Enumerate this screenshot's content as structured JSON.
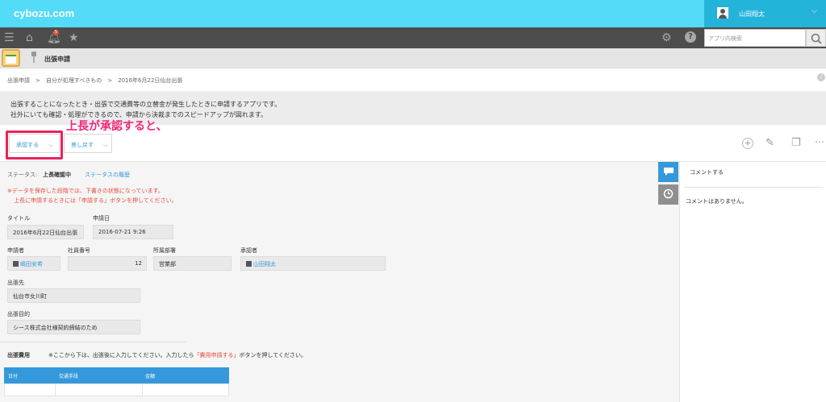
{
  "brand": {
    "logo": "cybozu.com",
    "accent": "#54dbf8",
    "user_bar": "#24b3d9"
  },
  "header": {
    "username": "山田翔太",
    "notification_count": "5",
    "search_placeholder": "アプリ内検索"
  },
  "app": {
    "name": "出張申請"
  },
  "breadcrumb": {
    "text": "出張申請　>　自分が処理すべきもの　>　2016年6月22日仙台出張"
  },
  "description": {
    "line1": "出張することになったとき・出張で交通費等の立替金が発生したときに申請するアプリです。",
    "line2": "社外にいても確認・処理ができるので、申請から決裁までのスピードアップが図れます。"
  },
  "annotation": "上長が承認すると、",
  "actions": {
    "approve": "承認する",
    "send_back": "差し戻す"
  },
  "status": {
    "label": "ステータス:",
    "value": "上長確認中",
    "history_link": "ステータスの履歴"
  },
  "notice": {
    "line1": "※データを保存した段階では、下書きの状態になっています。",
    "line2": "上長に申請するときには「申請する」ボタンを押してください。"
  },
  "fields": {
    "title_label": "タイトル",
    "title_value": "2016年6月22日仙台出張",
    "date_label": "申請日",
    "date_value": "2016-07-21 9:26",
    "applicant_label": "申請者",
    "applicant_value": "嶋田安希",
    "empno_label": "社員番号",
    "empno_value": "12",
    "dept_label": "所属部署",
    "dept_value": "営業部",
    "approver_label": "承認者",
    "approver_value": "山田翔太",
    "dest_label": "出張先",
    "dest_value": "仙台市女川町",
    "purpose_label": "出張目的",
    "purpose_value": "シース株式会社様契約締結のため"
  },
  "expenses": {
    "label": "出張費用",
    "note_pre": "※ここから下は、出張後に入力してください。入力したら",
    "note_em": "「費用申請する」",
    "note_post": "ボタンを押してください。",
    "columns": [
      "日付",
      "交通手段",
      "金額"
    ]
  },
  "sidebar": {
    "comment_prompt": "コメントする",
    "empty": "コメントはありません。"
  }
}
